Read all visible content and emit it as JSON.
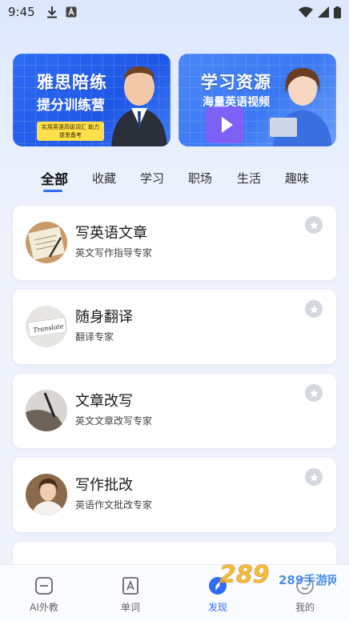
{
  "status_bar": {
    "time": "9:45"
  },
  "banners": [
    {
      "title": "雅思陪练",
      "subtitle": "提分训练营",
      "tag": "实用英语高级词汇 助力提思备考"
    },
    {
      "title": "学习资源",
      "subtitle": "海量英语视频"
    }
  ],
  "tabs": [
    "全部",
    "收藏",
    "学习",
    "职场",
    "生活",
    "趣味"
  ],
  "cards": [
    {
      "title": "写英语文章",
      "subtitle": "英文写作指导专家"
    },
    {
      "title": "随身翻译",
      "subtitle": "翻译专家",
      "avatar_text": "Translate"
    },
    {
      "title": "文章改写",
      "subtitle": "英文文章改写专家"
    },
    {
      "title": "写作批改",
      "subtitle": "英语作文批改专家"
    }
  ],
  "bottom_nav": [
    {
      "label": "AI外教",
      "icon": "chat-icon"
    },
    {
      "label": "单词",
      "icon": "word-book-icon"
    },
    {
      "label": "发现",
      "icon": "compass-icon",
      "active": true
    },
    {
      "label": "我的",
      "icon": "profile-icon"
    }
  ],
  "watermark": {
    "text": "289手游网"
  },
  "colors": {
    "accent": "#2f6df5",
    "banner_blue": "#1e56e6",
    "tag_yellow": "#ffe04a"
  }
}
